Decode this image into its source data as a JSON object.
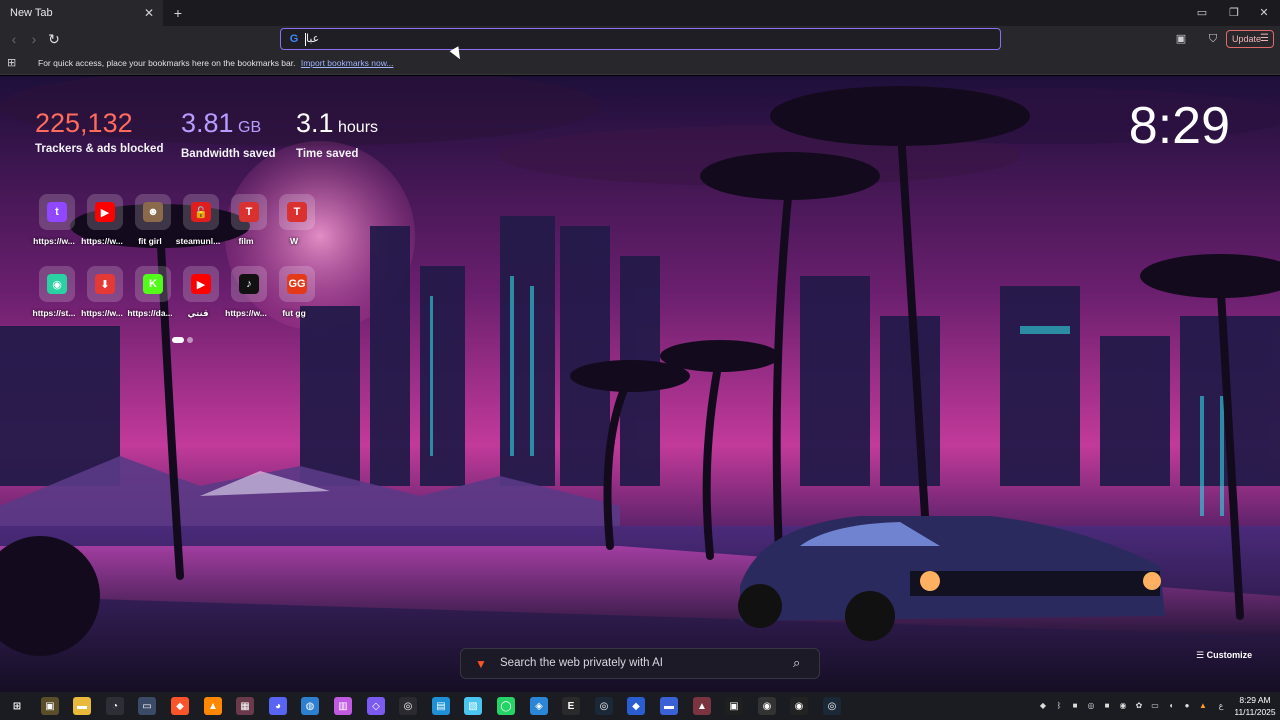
{
  "tab": {
    "title": "New Tab"
  },
  "omnibox": {
    "value": "عبا"
  },
  "toolbar": {
    "update_label": "Update"
  },
  "bookmarks_bar": {
    "message": "For quick access, place your bookmarks here on the bookmarks bar.",
    "import_link": "Import bookmarks now..."
  },
  "stats": [
    {
      "value": "225,132",
      "unit": "",
      "label": "Trackers & ads blocked",
      "color": "#ff6b5c"
    },
    {
      "value": "3.81",
      "unit": " GB",
      "label": "Bandwidth saved",
      "color": "#b99cff"
    },
    {
      "value": "3.1",
      "unit": " hours",
      "label": "Time saved",
      "color": "#ffffff"
    }
  ],
  "clock": "8:29",
  "shortcuts": [
    {
      "label": "https://w...",
      "icon": "twitch-icon",
      "color": "#9146ff",
      "glyph": "t"
    },
    {
      "label": "https://w...",
      "icon": "youtube-icon",
      "color": "#ff0000",
      "glyph": "▶"
    },
    {
      "label": "fit girl",
      "icon": "fitgirl-icon",
      "color": "#8a6a4a",
      "glyph": "☻"
    },
    {
      "label": "steamunl...",
      "icon": "steamunlocked-icon",
      "color": "#e01e1e",
      "glyph": "🔓"
    },
    {
      "label": "film",
      "icon": "topcinema-icon",
      "color": "#d93030",
      "glyph": "T"
    },
    {
      "label": "W",
      "icon": "topcinema-icon-2",
      "color": "#d93030",
      "glyph": "T"
    },
    {
      "label": "https://st...",
      "icon": "android-icon",
      "color": "#2ad1a3",
      "glyph": "◉"
    },
    {
      "label": "https://w...",
      "icon": "download-icon",
      "color": "#e53935",
      "glyph": "⬇"
    },
    {
      "label": "https://da...",
      "icon": "kick-icon",
      "color": "#53fc18",
      "glyph": "K"
    },
    {
      "label": "قنتي",
      "icon": "youtube-icon-2",
      "color": "#ff0000",
      "glyph": "▶"
    },
    {
      "label": "https://w...",
      "icon": "tiktok-icon",
      "color": "#111111",
      "glyph": "♪"
    },
    {
      "label": "fut gg",
      "icon": "futgg-icon",
      "color": "#e53a1a",
      "glyph": "GG"
    }
  ],
  "search": {
    "placeholder": "Search the web privately with AI"
  },
  "customize_label": "Customize",
  "taskbar": {
    "time": "8:29 AM",
    "date": "11/11/2025",
    "lang": "ع",
    "apps": [
      {
        "icon": "windows-start-icon",
        "color": "#1a1c22",
        "glyph": "⊞"
      },
      {
        "icon": "app-icon-1",
        "color": "#5a4d2a",
        "glyph": "▣"
      },
      {
        "icon": "file-explorer-icon",
        "color": "#e8b93a",
        "glyph": "▬"
      },
      {
        "icon": "overwatch-icon",
        "color": "#2e2e36",
        "glyph": "◔"
      },
      {
        "icon": "app-icon-2",
        "color": "#3b4a66",
        "glyph": "▭"
      },
      {
        "icon": "brave-icon",
        "color": "#fb542b",
        "glyph": "◆"
      },
      {
        "icon": "vlc-icon",
        "color": "#ff8800",
        "glyph": "▲"
      },
      {
        "icon": "app-icon-3",
        "color": "#6b3a4a",
        "glyph": "▦"
      },
      {
        "icon": "discord-icon",
        "color": "#5865f2",
        "glyph": "◕"
      },
      {
        "icon": "app-icon-4",
        "color": "#2d7fcf",
        "glyph": "◍"
      },
      {
        "icon": "app-icon-5",
        "color": "#c05ae0",
        "glyph": "▥"
      },
      {
        "icon": "gamepad-icon",
        "color": "#7a5af0",
        "glyph": "◇"
      },
      {
        "icon": "steam-icon",
        "color": "#2a2a30",
        "glyph": "◎"
      },
      {
        "icon": "app-icon-6",
        "color": "#1e90d6",
        "glyph": "▤"
      },
      {
        "icon": "app-icon-7",
        "color": "#48c6f0",
        "glyph": "▧"
      },
      {
        "icon": "whatsapp-icon",
        "color": "#25d366",
        "glyph": "◯"
      },
      {
        "icon": "app-icon-8",
        "color": "#2b86d8",
        "glyph": "◈"
      },
      {
        "icon": "epic-games-icon",
        "color": "#2a2a2a",
        "glyph": "E"
      },
      {
        "icon": "steam-icon-2",
        "color": "#1b2838",
        "glyph": "◎"
      },
      {
        "icon": "app-icon-9",
        "color": "#2a5dd0",
        "glyph": "◆"
      },
      {
        "icon": "app-icon-10",
        "color": "#3a62d6",
        "glyph": "▬"
      },
      {
        "icon": "app-icon-11",
        "color": "#7a3440",
        "glyph": "▲"
      },
      {
        "icon": "app-icon-12",
        "color": "#1f1f1f",
        "glyph": "▣"
      },
      {
        "icon": "app-icon-13",
        "color": "#333333",
        "glyph": "◉"
      },
      {
        "icon": "eye-icon",
        "color": "#222222",
        "glyph": "◉"
      },
      {
        "icon": "steam-icon-3",
        "color": "#1b2838",
        "glyph": "◎"
      }
    ]
  }
}
